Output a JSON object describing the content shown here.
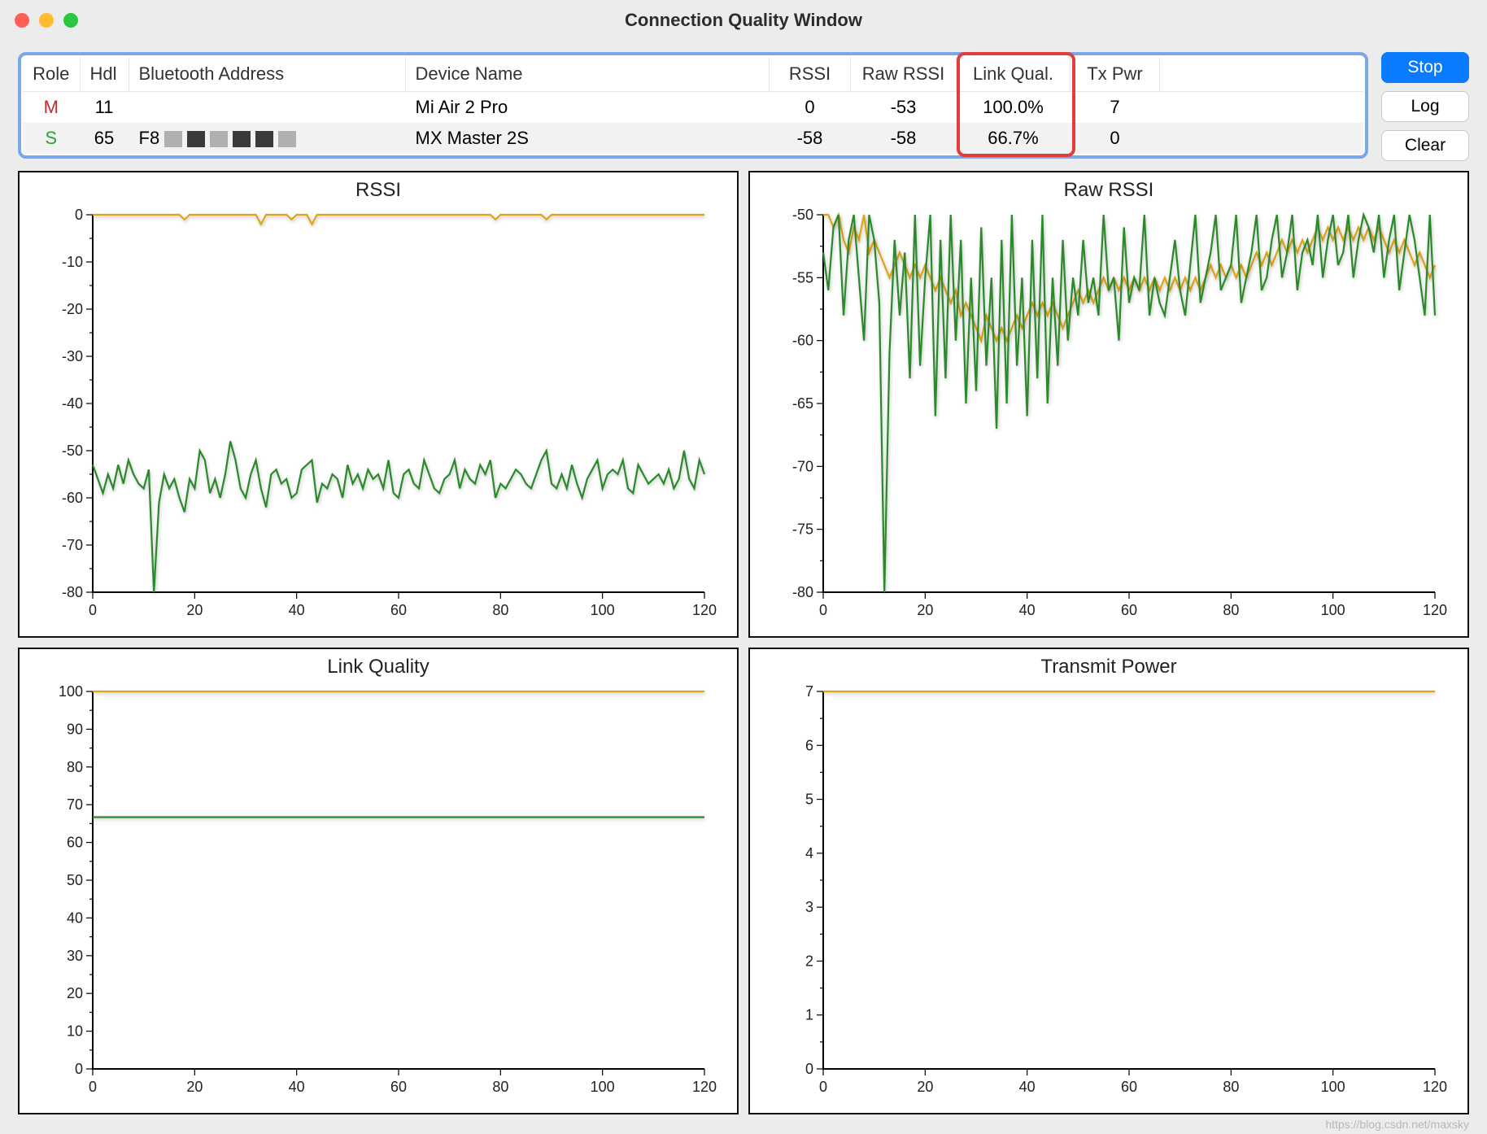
{
  "window": {
    "title": "Connection Quality Window"
  },
  "buttons": {
    "stop": "Stop",
    "log": "Log",
    "clear": "Clear"
  },
  "colors": {
    "series_m": "#e0a415",
    "series_s": "#2a8a2a",
    "highlight": "#e33c3c"
  },
  "table": {
    "headers": {
      "role": "Role",
      "hdl": "Hdl",
      "bt_addr": "Bluetooth Address",
      "dev_name": "Device Name",
      "rssi": "RSSI",
      "raw_rssi": "Raw RSSI",
      "link_qual": "Link Qual.",
      "tx_pwr": "Tx Pwr"
    },
    "rows": [
      {
        "role": "M",
        "hdl": "11",
        "bt_addr": "",
        "dev_name": "Mi Air 2 Pro",
        "rssi": "0",
        "raw_rssi": "-53",
        "link_qual": "100.0%",
        "tx_pwr": "7"
      },
      {
        "role": "S",
        "hdl": "65",
        "bt_addr": "F8",
        "dev_name": "MX Master 2S",
        "rssi": "-58",
        "raw_rssi": "-58",
        "link_qual": "66.7%",
        "tx_pwr": "0"
      }
    ]
  },
  "charts": {
    "rssi": {
      "title": "RSSI"
    },
    "raw_rssi": {
      "title": "Raw RSSI"
    },
    "link_quality": {
      "title": "Link Quality"
    },
    "tx_power": {
      "title": "Transmit Power"
    }
  },
  "chart_data": [
    {
      "id": "rssi",
      "type": "line",
      "title": "RSSI",
      "xlabel": "",
      "ylabel": "",
      "xlim": [
        0,
        120
      ],
      "ylim": [
        -80,
        0
      ],
      "xticks": [
        0,
        20,
        40,
        60,
        80,
        100,
        120
      ],
      "yticks": [
        -80,
        -70,
        -60,
        -50,
        -40,
        -30,
        -20,
        -10,
        0
      ],
      "series": [
        {
          "name": "M",
          "y": [
            0,
            0,
            0,
            0,
            0,
            0,
            0,
            0,
            0,
            0,
            0,
            0,
            0,
            0,
            0,
            0,
            0,
            0,
            -1,
            0,
            0,
            0,
            0,
            0,
            0,
            0,
            0,
            0,
            0,
            0,
            0,
            0,
            0,
            -2,
            0,
            0,
            0,
            0,
            0,
            -1,
            0,
            0,
            0,
            -2,
            0,
            0,
            0,
            0,
            0,
            0,
            0,
            0,
            0,
            0,
            0,
            0,
            0,
            0,
            0,
            0,
            0,
            0,
            0,
            0,
            0,
            0,
            0,
            0,
            0,
            0,
            0,
            0,
            0,
            0,
            0,
            0,
            0,
            0,
            0,
            -1,
            0,
            0,
            0,
            0,
            0,
            0,
            0,
            0,
            0,
            -1,
            0,
            0,
            0,
            0,
            0,
            0,
            0,
            0,
            0,
            0,
            0,
            0,
            0,
            0,
            0,
            0,
            0,
            0,
            0,
            0,
            0,
            0,
            0,
            0,
            0,
            0,
            0,
            0,
            0,
            0,
            0
          ]
        },
        {
          "name": "S",
          "y": [
            -53,
            -56,
            -59,
            -55,
            -58,
            -53,
            -57,
            -52,
            -55,
            -57,
            -58,
            -54,
            -80,
            -61,
            -55,
            -58,
            -56,
            -60,
            -63,
            -56,
            -58,
            -50,
            -52,
            -59,
            -56,
            -60,
            -55,
            -48,
            -52,
            -58,
            -60,
            -55,
            -52,
            -58,
            -62,
            -55,
            -54,
            -57,
            -56,
            -60,
            -59,
            -54,
            -53,
            -52,
            -61,
            -57,
            -58,
            -55,
            -56,
            -60,
            -53,
            -57,
            -55,
            -58,
            -54,
            -56,
            -55,
            -58,
            -52,
            -59,
            -60,
            -55,
            -54,
            -57,
            -58,
            -52,
            -55,
            -58,
            -59,
            -56,
            -55,
            -52,
            -58,
            -54,
            -56,
            -57,
            -53,
            -55,
            -52,
            -60,
            -57,
            -58,
            -56,
            -54,
            -55,
            -57,
            -58,
            -55,
            -52,
            -50,
            -57,
            -58,
            -55,
            -58,
            -53,
            -57,
            -60,
            -56,
            -54,
            -52,
            -58,
            -55,
            -54,
            -55,
            -52,
            -58,
            -59,
            -53,
            -55,
            -57,
            -56,
            -55,
            -57,
            -54,
            -58,
            -56,
            -50,
            -56,
            -58,
            -52,
            -55
          ]
        }
      ]
    },
    {
      "id": "raw_rssi",
      "type": "line",
      "title": "Raw RSSI",
      "xlabel": "",
      "ylabel": "",
      "xlim": [
        0,
        120
      ],
      "ylim": [
        -80,
        -50
      ],
      "xticks": [
        0,
        20,
        40,
        60,
        80,
        100,
        120
      ],
      "yticks": [
        -80,
        -75,
        -70,
        -65,
        -60,
        -55,
        -50
      ],
      "series": [
        {
          "name": "M",
          "y": [
            -50,
            -50,
            -51,
            -50,
            -52,
            -53,
            -51,
            -52,
            -50,
            -53,
            -52,
            -53,
            -54,
            -55,
            -54,
            -53,
            -54,
            -55,
            -54,
            -55,
            -54,
            -55,
            -56,
            -55,
            -56,
            -57,
            -56,
            -58,
            -57,
            -58,
            -59,
            -60,
            -58,
            -59,
            -60,
            -59,
            -60,
            -59,
            -58,
            -59,
            -58,
            -57,
            -58,
            -57,
            -58,
            -57,
            -58,
            -59,
            -58,
            -57,
            -56,
            -57,
            -56,
            -57,
            -56,
            -55,
            -56,
            -55,
            -56,
            -55,
            -56,
            -55,
            -56,
            -55,
            -56,
            -55,
            -56,
            -55,
            -56,
            -55,
            -56,
            -55,
            -56,
            -55,
            -56,
            -55,
            -54,
            -55,
            -54,
            -55,
            -54,
            -55,
            -54,
            -55,
            -54,
            -53,
            -54,
            -53,
            -54,
            -53,
            -52,
            -53,
            -52,
            -53,
            -52,
            -53,
            -52,
            -51,
            -52,
            -51,
            -52,
            -51,
            -52,
            -51,
            -52,
            -51,
            -52,
            -51,
            -52,
            -51,
            -52,
            -53,
            -52,
            -53,
            -52,
            -53,
            -54,
            -53,
            -54,
            -55,
            -54
          ]
        },
        {
          "name": "S",
          "y": [
            -53,
            -56,
            -51,
            -50,
            -58,
            -52,
            -50,
            -55,
            -60,
            -50,
            -52,
            -57,
            -80,
            -61,
            -52,
            -58,
            -53,
            -63,
            -50,
            -62,
            -55,
            -50,
            -66,
            -52,
            -63,
            -50,
            -60,
            -52,
            -65,
            -55,
            -64,
            -51,
            -62,
            -55,
            -67,
            -52,
            -65,
            -50,
            -62,
            -55,
            -66,
            -52,
            -63,
            -50,
            -65,
            -55,
            -62,
            -52,
            -60,
            -55,
            -58,
            -52,
            -57,
            -55,
            -58,
            -50,
            -56,
            -55,
            -60,
            -51,
            -57,
            -55,
            -56,
            -50,
            -58,
            -55,
            -57,
            -58,
            -55,
            -52,
            -56,
            -58,
            -54,
            -50,
            -57,
            -55,
            -53,
            -50,
            -56,
            -55,
            -54,
            -50,
            -57,
            -55,
            -53,
            -50,
            -56,
            -55,
            -52,
            -50,
            -55,
            -53,
            -50,
            -56,
            -53,
            -52,
            -54,
            -50,
            -55,
            -52,
            -50,
            -54,
            -53,
            -50,
            -55,
            -52,
            -50,
            -51,
            -53,
            -50,
            -55,
            -52,
            -50,
            -56,
            -53,
            -50,
            -52,
            -55,
            -58,
            -50,
            -58
          ]
        }
      ]
    },
    {
      "id": "link_quality",
      "type": "line",
      "title": "Link Quality",
      "xlabel": "",
      "ylabel": "",
      "xlim": [
        0,
        120
      ],
      "ylim": [
        0,
        100
      ],
      "xticks": [
        0,
        20,
        40,
        60,
        80,
        100,
        120
      ],
      "yticks": [
        0,
        10,
        20,
        30,
        40,
        50,
        60,
        70,
        80,
        90,
        100
      ],
      "series": [
        {
          "name": "M",
          "y_const": 100
        },
        {
          "name": "S",
          "y_const": 66.7
        }
      ]
    },
    {
      "id": "tx_power",
      "type": "line",
      "title": "Transmit Power",
      "xlabel": "",
      "ylabel": "",
      "xlim": [
        0,
        120
      ],
      "ylim": [
        0,
        7
      ],
      "xticks": [
        0,
        20,
        40,
        60,
        80,
        100,
        120
      ],
      "yticks": [
        0,
        1,
        2,
        3,
        4,
        5,
        6,
        7
      ],
      "series": [
        {
          "name": "M",
          "y_const": 7
        }
      ]
    }
  ],
  "watermark": "https://blog.csdn.net/maxsky"
}
